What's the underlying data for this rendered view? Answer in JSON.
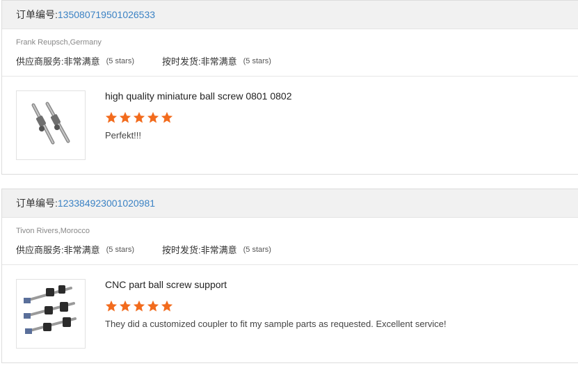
{
  "colors": {
    "star": "#f26b1d",
    "link": "#3b82c4"
  },
  "reviews": [
    {
      "order_label": "订单编号: ",
      "order_number": "135080719501026533",
      "buyer": "Frank Reupsch,Germany",
      "supplier_service_label": "供应商服务: ",
      "supplier_service_value": "非常满意",
      "supplier_service_stars": "(5 stars)",
      "delivery_label": "按时发货: ",
      "delivery_value": "非常满意",
      "delivery_stars": "(5 stars)",
      "product_title": "high quality miniature ball screw 0801 0802",
      "product_image_icon": "ball-screw-image",
      "rating": 5,
      "comment": "Perfekt!!!"
    },
    {
      "order_label": "订单编号: ",
      "order_number": "123384923001020981",
      "buyer": "Tivon Rivers,Morocco",
      "supplier_service_label": "供应商服务: ",
      "supplier_service_value": "非常满意",
      "supplier_service_stars": "(5 stars)",
      "delivery_label": "按时发货: ",
      "delivery_value": "非常满意",
      "delivery_stars": "(5 stars)",
      "product_title": "CNC part ball screw support",
      "product_image_icon": "ball-screw-support-image",
      "rating": 5,
      "comment": "They did a customized coupler to fit my sample parts as requested. Excellent service!"
    }
  ]
}
